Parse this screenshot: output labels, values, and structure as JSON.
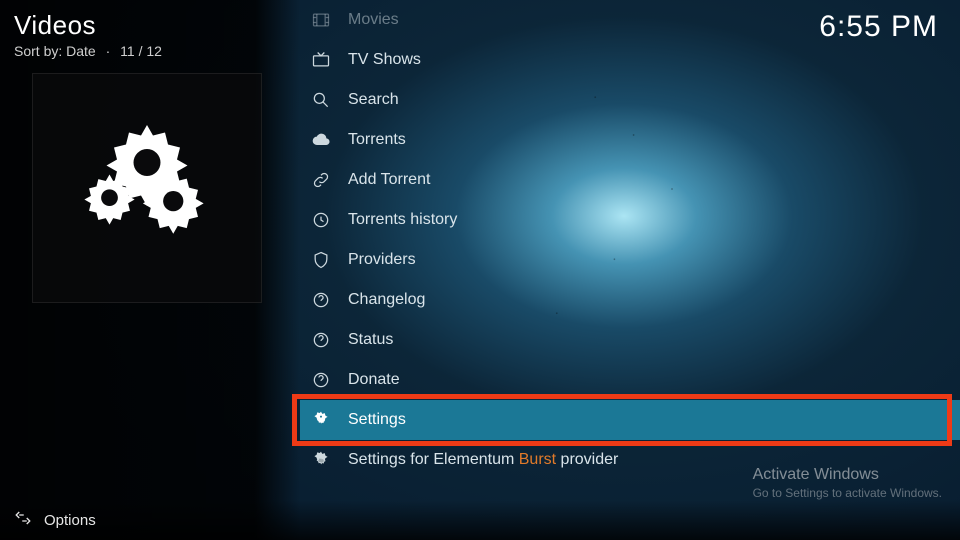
{
  "header": {
    "title": "Videos",
    "sort_prefix": "Sort by:",
    "sort_value": "Date",
    "position": "11 / 12"
  },
  "clock": "6:55 PM",
  "menu": {
    "items": [
      {
        "icon": "movies-icon",
        "label": "Movies",
        "dim": true,
        "selected": false
      },
      {
        "icon": "tv-icon",
        "label": "TV Shows",
        "dim": false,
        "selected": false
      },
      {
        "icon": "search-icon",
        "label": "Search",
        "dim": false,
        "selected": false
      },
      {
        "icon": "cloud-icon",
        "label": "Torrents",
        "dim": false,
        "selected": false
      },
      {
        "icon": "link-icon",
        "label": "Add Torrent",
        "dim": false,
        "selected": false
      },
      {
        "icon": "clock-icon",
        "label": "Torrents history",
        "dim": false,
        "selected": false
      },
      {
        "icon": "shield-icon",
        "label": "Providers",
        "dim": false,
        "selected": false
      },
      {
        "icon": "help-icon",
        "label": "Changelog",
        "dim": false,
        "selected": false
      },
      {
        "icon": "help-icon",
        "label": "Status",
        "dim": false,
        "selected": false
      },
      {
        "icon": "help-icon",
        "label": "Donate",
        "dim": false,
        "selected": false
      },
      {
        "icon": "gear-icon",
        "label": "Settings",
        "dim": false,
        "selected": true
      },
      {
        "icon": "gear-icon",
        "label_pre": "Settings for Elementum ",
        "label_hl": "Burst",
        "label_post": " provider",
        "dim": false,
        "selected": false
      }
    ]
  },
  "footer": {
    "options": "Options"
  },
  "watermark": {
    "line1": "Activate Windows",
    "line2": "Go to Settings to activate Windows."
  }
}
